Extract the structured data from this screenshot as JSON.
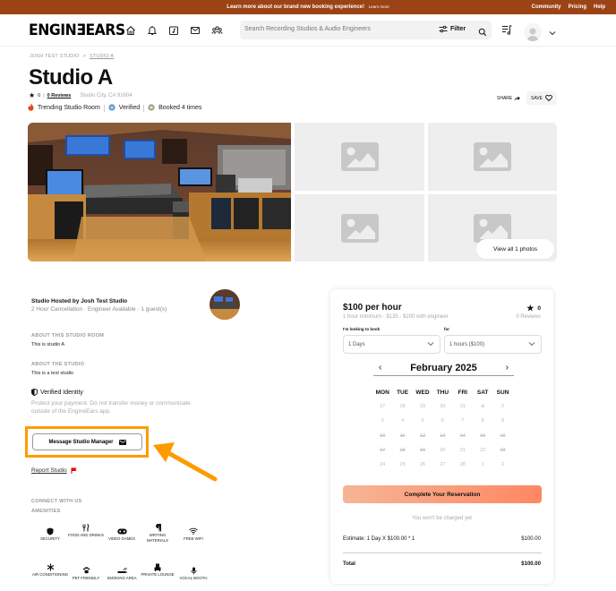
{
  "banner": {
    "message": "Learn more about our brand new booking experience!",
    "learn_more": "Learn more",
    "links": [
      "Community",
      "Pricing",
      "Help"
    ]
  },
  "nav": {
    "logo": "ENGINƎEARS",
    "icons": [
      "home-icon",
      "bell-icon",
      "music-folder-icon",
      "mail-icon",
      "community-icon"
    ],
    "search_placeholder": "Search Recording Studios & Audio Engineers",
    "filter_label": "Filter"
  },
  "breadcrumb": {
    "parent": "JOSH TEST STUDIO",
    "separator": ">",
    "current": "STUDIO A"
  },
  "header": {
    "title": "Studio A",
    "rating": "0",
    "reviews_link": "0 Reviews",
    "location": "Studio City, CA 91604",
    "badges": [
      "Trending Studio Room",
      "Verified",
      "Booked 4 times"
    ],
    "share_label": "SHARE",
    "save_label": "SAVE"
  },
  "gallery": {
    "view_all": "View all 1 photos"
  },
  "host": {
    "title": "Studio Hosted by Josh Test Studio",
    "subtitle": "2 Hour Cancellation · Engineer Available · 1 guest(s)"
  },
  "about_room": {
    "label": "ABOUT THIS STUDIO ROOM",
    "text": "This is studio A"
  },
  "about_studio": {
    "label": "ABOUT THE STUDIO",
    "text": "This is a test studio"
  },
  "verified": {
    "title": "Verified Identity",
    "text": "Protect your payment. Do not transfer money or communicate outside of the EngineEars app."
  },
  "actions": {
    "message_button": "Message Studio Manager",
    "report_link": "Report Studio"
  },
  "connect": {
    "label": "CONNECT WITH US"
  },
  "amenities": {
    "label": "AMENITIES",
    "items": [
      {
        "label": "SECURITY",
        "icon": "shield-icon"
      },
      {
        "label": "FOOD AND DRINKS",
        "icon": "utensils-icon"
      },
      {
        "label": "VIDEO GAMES",
        "icon": "gamepad-icon"
      },
      {
        "label": "WRITING MATERIALS",
        "icon": "paragraph-icon"
      },
      {
        "label": "FREE WIFI",
        "icon": "wifi-icon"
      },
      {
        "label": "AIR CONDITIONING",
        "icon": "snowflake-icon"
      },
      {
        "label": "PET FRIENDLY",
        "icon": "paw-icon"
      },
      {
        "label": "SMOKING AREA",
        "icon": "smoking-icon"
      },
      {
        "label": "PRIVATE LOUNGE",
        "icon": "lounge-icon"
      },
      {
        "label": "VOCAL BOOTH",
        "icon": "microphone-icon"
      }
    ]
  },
  "booking": {
    "price": "$100 per hour",
    "price_sub": "1 hour minimum · $135 - $200 with engineer",
    "rating": "0",
    "reviews": "0 Reviews",
    "book_label": "I'm looking to book",
    "book_value": "1 Days",
    "for_label": "for",
    "for_value": "1 hours ($100)",
    "month": "February 2025",
    "weekdays": [
      "MON",
      "TUE",
      "WED",
      "THU",
      "FRI",
      "SAT",
      "SUN"
    ],
    "weeks": [
      [
        {
          "d": "27",
          "s": false
        },
        {
          "d": "28",
          "s": false
        },
        {
          "d": "29",
          "s": false
        },
        {
          "d": "30",
          "s": false
        },
        {
          "d": "31",
          "s": false
        },
        {
          "d": "1",
          "s": true
        },
        {
          "d": "2",
          "s": false
        }
      ],
      [
        {
          "d": "3",
          "s": false
        },
        {
          "d": "4",
          "s": false
        },
        {
          "d": "5",
          "s": false
        },
        {
          "d": "6",
          "s": false
        },
        {
          "d": "7",
          "s": false
        },
        {
          "d": "8",
          "s": false
        },
        {
          "d": "9",
          "s": false
        }
      ],
      [
        {
          "d": "10",
          "s": true
        },
        {
          "d": "11",
          "s": true
        },
        {
          "d": "12",
          "s": true
        },
        {
          "d": "13",
          "s": true
        },
        {
          "d": "14",
          "s": true
        },
        {
          "d": "15",
          "s": true
        },
        {
          "d": "16",
          "s": true
        }
      ],
      [
        {
          "d": "17",
          "s": true
        },
        {
          "d": "18",
          "s": true
        },
        {
          "d": "19",
          "s": true
        },
        {
          "d": "20",
          "s": false
        },
        {
          "d": "21",
          "s": false
        },
        {
          "d": "22",
          "s": false
        },
        {
          "d": "23",
          "s": true
        }
      ],
      [
        {
          "d": "24",
          "s": false
        },
        {
          "d": "25",
          "s": false
        },
        {
          "d": "26",
          "s": false
        },
        {
          "d": "27",
          "s": false
        },
        {
          "d": "28",
          "s": false
        },
        {
          "d": "1",
          "s": false
        },
        {
          "d": "2",
          "s": false
        }
      ]
    ],
    "complete_button": "Complete Your Reservation",
    "no_charge": "You won't be charged yet",
    "estimate_label": "Estimate: 1 Day X $100.00 * 1",
    "estimate_value": "$100.00",
    "total_label": "Total",
    "total_value": "$100.00"
  },
  "colors": {
    "banner": "#9c4315",
    "highlight": "#ff9a00",
    "cta_start": "#f6b595",
    "cta_end": "#ff8763",
    "report_flag": "#e00000"
  }
}
